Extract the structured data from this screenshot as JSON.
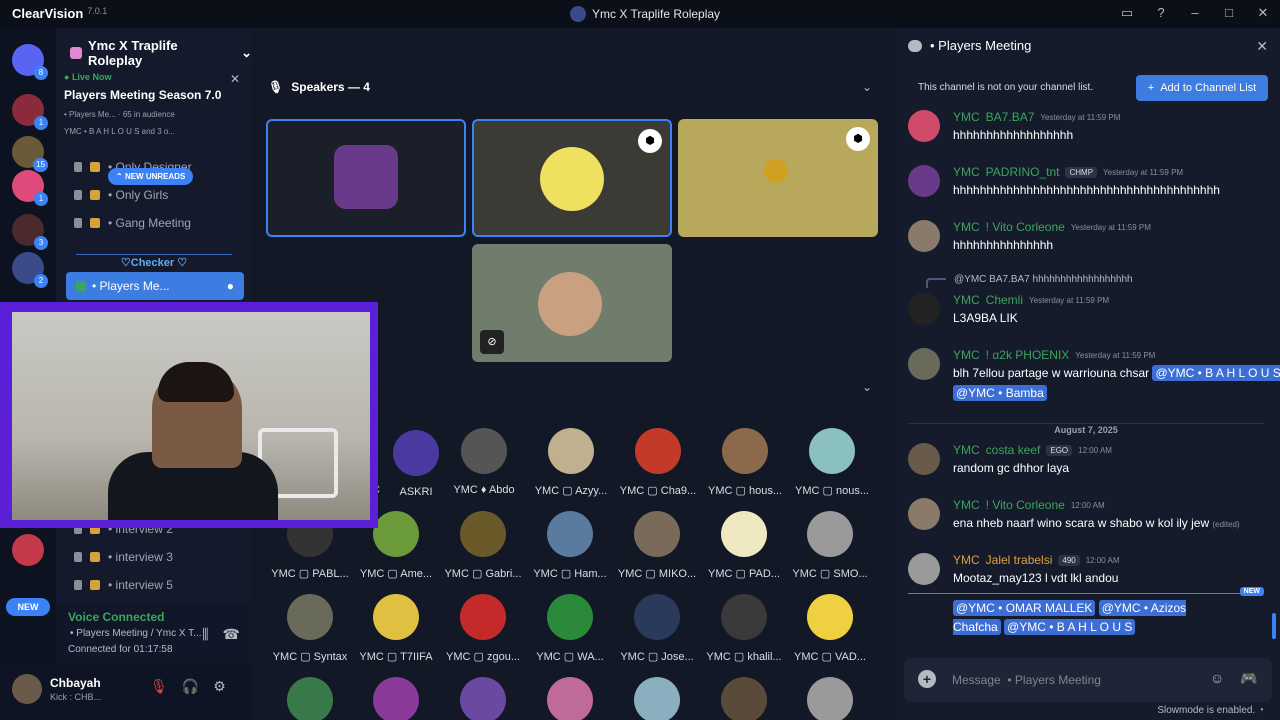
{
  "app": {
    "name": "ClearVision",
    "version": "7.0.1",
    "window_title": "Ymc X Traplife Roleplay"
  },
  "titlebar_icons": [
    "inbox-icon",
    "help-icon",
    "minimize-icon",
    "maximize-icon",
    "close-icon"
  ],
  "rail": {
    "home_badge": "8",
    "servers": [
      {
        "badge": "1",
        "color": "#8a2a3a"
      },
      {
        "badge": "15",
        "color": "#6a5a3a"
      },
      {
        "badge": "1",
        "color": "#e04a7a"
      },
      {
        "badge": "3",
        "color": "#4a2a2a"
      },
      {
        "badge": "2",
        "color": "#3a4a8a"
      }
    ],
    "new_label": "NEW"
  },
  "sidebar": {
    "server_name": "Ymc X Traplife Roleplay",
    "live": {
      "label": "Live Now",
      "title": "Players Meeting Season 7.0",
      "channel": "• Players Me...",
      "audience": "65 in audience",
      "members": "YMC  • B A H L O U S and 3 o..."
    },
    "channels_top": [
      "• Only Designer",
      "• Only Girls",
      "• Gang Meeting"
    ],
    "new_unreads": "NEW UNREADS",
    "category": "♡Checker ♡",
    "active_channel": "• Players Me...",
    "channels_bottom": [
      "• interview 2",
      "• interview 3",
      "• interview 5"
    ]
  },
  "voice": {
    "status": "Voice Connected",
    "channel": "• Players Meeting / Ymc X T...",
    "connected": "Connected for 01:17:58"
  },
  "user": {
    "name": "Chbayah",
    "status": "Kick : CHB..."
  },
  "stage": {
    "speakers_label": "Speakers — 4",
    "audience": [
      [
        "ASKRI",
        "Abdo",
        "Azyy...",
        "Cha9...",
        "hous...",
        "nous..."
      ],
      [
        "PABL...",
        "Ame...",
        "Gabri...",
        "Ham...",
        "MIKO...",
        "PAD...",
        "SMO..."
      ],
      [
        "Syntax",
        "T7IIFA",
        "zgou...",
        "WA...",
        "Jose...",
        "khalil...",
        "VAD..."
      ]
    ],
    "audience_prefix": "YMC",
    "row1_first_fragment": "C"
  },
  "chat": {
    "channel": "• Players Meeting",
    "notice": "This channel is not on your channel list.",
    "add_button": "Add to Channel List",
    "clan": "YMC",
    "messages": [
      {
        "user": "BA7.BA7",
        "time": "Yesterday at 11:59 PM",
        "text": "hhhhhhhhhhhhhhhhhh"
      },
      {
        "user": "PADRINO_tnt",
        "tag": "CHMP",
        "time": "Yesterday at 11:59 PM",
        "text": "hhhhhhhhhhhhhhhhhhhhhhhhhhhhhhhhhhhhhhhh"
      },
      {
        "user": "! Vito Corleone",
        "time": "Yesterday at 11:59 PM",
        "text": "hhhhhhhhhhhhhhh"
      },
      {
        "user": "Chemli",
        "time": "Yesterday at 11:59 PM",
        "text": "L3A9BA LIK"
      },
      {
        "user": "! α2k PHOENIX",
        "time": "Yesterday at 11:59 PM",
        "text": "blh 7ellou partage w warriouna chsar"
      },
      {
        "user": "costa keef",
        "tag": "EGO",
        "time": "12:00 AM",
        "text": "random gc dhhor laya"
      },
      {
        "user": "! Vito Corleone",
        "time": "12:00 AM",
        "text": "ena nheb naarf wino scara w shabo w kol ily jew",
        "edited": "(edited)"
      },
      {
        "user": "Jalel trabelsi",
        "tag": "490",
        "time": "12:00 AM",
        "text": "Mootaz_may123 l vdt lkl andou"
      }
    ],
    "reply_preview": "@YMC  BA7.BA7 hhhhhhhhhhhhhhhhhh",
    "mentions_phoenix": [
      "@YMC • B A H L O U S",
      "@YMC • Bamba"
    ],
    "date_divider": "August 7, 2025",
    "new_label": "NEW",
    "cont_mentions": [
      "@YMC • OMAR MALLEK",
      "@YMC • Azizos Chafcha",
      "@YMC • B A H L O U S"
    ],
    "composer_placeholder": "Message  • Players Meeting",
    "slowmode": "Slowmode is enabled."
  }
}
